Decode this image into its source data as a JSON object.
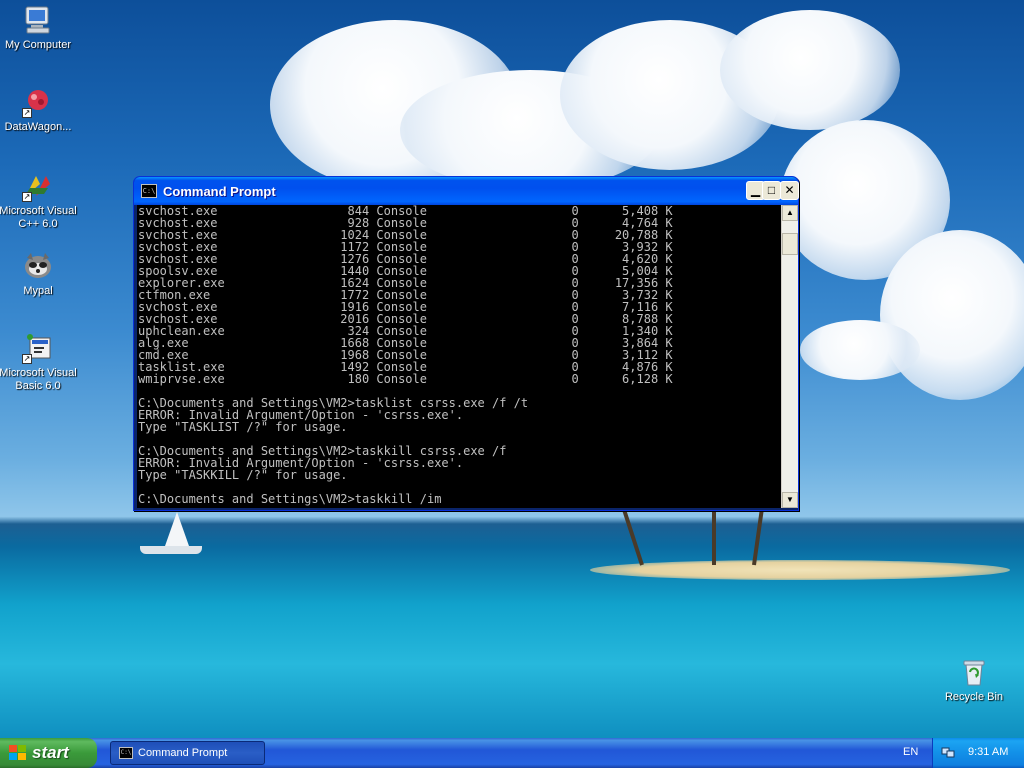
{
  "desktop": {
    "icons": [
      {
        "label": "My Computer"
      },
      {
        "label": "DataWagon..."
      },
      {
        "label": "Microsoft Visual C++ 6.0"
      },
      {
        "label": "Mypal"
      },
      {
        "label": "Microsoft Visual Basic 6.0"
      },
      {
        "label": "Recycle Bin"
      }
    ]
  },
  "window": {
    "title": "Command Prompt",
    "icon": "cmd-icon",
    "icon_text": "C:\\",
    "buttons": {
      "minimize": "minimize-icon",
      "maximize": "maximize-icon",
      "close": "close-icon"
    },
    "console_lines": [
      "svchost.exe                  844 Console                    0      5,408 K",
      "svchost.exe                  928 Console                    0      4,764 K",
      "svchost.exe                 1024 Console                    0     20,788 K",
      "svchost.exe                 1172 Console                    0      3,932 K",
      "svchost.exe                 1276 Console                    0      4,620 K",
      "spoolsv.exe                 1440 Console                    0      5,004 K",
      "explorer.exe                1624 Console                    0     17,356 K",
      "ctfmon.exe                  1772 Console                    0      3,732 K",
      "svchost.exe                 1916 Console                    0      7,116 K",
      "svchost.exe                 2016 Console                    0      8,788 K",
      "uphclean.exe                 324 Console                    0      1,340 K",
      "alg.exe                     1668 Console                    0      3,864 K",
      "cmd.exe                     1968 Console                    0      3,112 K",
      "tasklist.exe                1492 Console                    0      4,876 K",
      "wmiprvse.exe                 180 Console                    0      6,128 K",
      "",
      "C:\\Documents and Settings\\VM2>tasklist csrss.exe /f /t",
      "ERROR: Invalid Argument/Option - 'csrss.exe'.",
      "Type \"TASKLIST /?\" for usage.",
      "",
      "C:\\Documents and Settings\\VM2>taskkill csrss.exe /f",
      "ERROR: Invalid Argument/Option - 'csrss.exe'.",
      "Type \"TASKKILL /?\" for usage.",
      "",
      "C:\\Documents and Settings\\VM2>taskkill /im"
    ]
  },
  "taskbar": {
    "start_label": "start",
    "task_button_label": "Command Prompt",
    "language": "EN",
    "clock": "9:31 AM"
  }
}
